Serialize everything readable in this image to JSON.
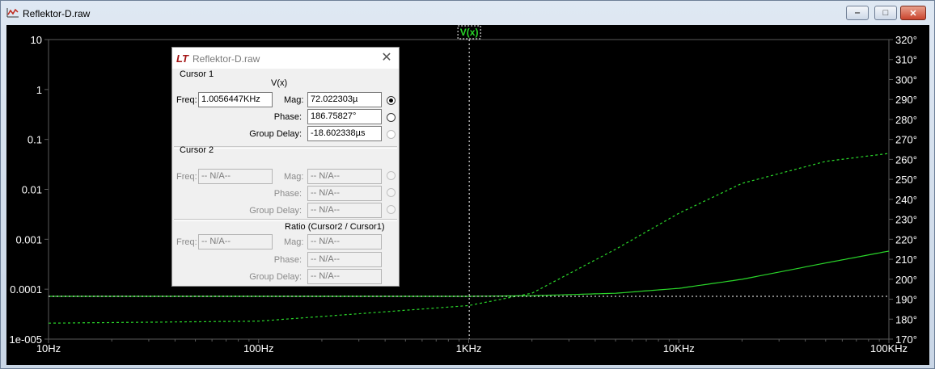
{
  "window": {
    "title": "Reflektor-D.raw",
    "minimize_glyph": "‒",
    "maximize_glyph": "□",
    "close_glyph": "✕"
  },
  "plot": {
    "trace_label": "V(x)",
    "left_ticks": [
      "10",
      "1",
      "0.1",
      "0.01",
      "0.001",
      "0.0001",
      "1e-005"
    ],
    "right_ticks": [
      "320°",
      "310°",
      "300°",
      "290°",
      "280°",
      "270°",
      "260°",
      "250°",
      "240°",
      "230°",
      "220°",
      "210°",
      "200°",
      "190°",
      "180°",
      "170°"
    ],
    "x_ticks": [
      "10Hz",
      "100Hz",
      "1KHz",
      "10KHz",
      "100KHz"
    ],
    "colors": {
      "trace": "#2ad62a",
      "grid": "#5a5a5a",
      "text": "#ffffff",
      "background": "#000000"
    }
  },
  "chart_data": {
    "type": "line",
    "title": "",
    "x_scale": "log",
    "xlim_hz": [
      10,
      100000
    ],
    "y_left": {
      "scale": "log",
      "lim": [
        1e-05,
        10
      ]
    },
    "y_right": {
      "unit": "°",
      "lim": [
        170,
        320
      ]
    },
    "cursor_freq_hz": 1005.6447,
    "cursor_mag": 7.2e-05,
    "series": [
      {
        "axis": "left",
        "style": "solid",
        "x": [
          10,
          100,
          1000,
          2000,
          5000,
          10000,
          20000,
          50000,
          100000
        ],
        "y": [
          7.2e-05,
          7.2e-05,
          7.2e-05,
          7.4e-05,
          8.3e-05,
          0.000104,
          0.000158,
          0.000335,
          0.00058
        ]
      },
      {
        "axis": "right",
        "style": "dashed",
        "x": [
          10,
          100,
          1000,
          2000,
          5000,
          10000,
          20000,
          50000,
          100000
        ],
        "y": [
          178,
          179,
          186.8,
          193,
          215,
          233,
          248,
          259,
          263
        ]
      }
    ]
  },
  "dialog": {
    "title": "Reflektor-D.raw",
    "logo": "LT",
    "cursor1": {
      "header": "Cursor 1",
      "trace": "V(x)",
      "freq_label": "Freq:",
      "freq": "1.0056447KHz",
      "mag_label": "Mag:",
      "mag": "72.022303µ",
      "phase_label": "Phase:",
      "phase": "186.75827°",
      "gd_label": "Group Delay:",
      "gd": "-18.602338µs"
    },
    "cursor2": {
      "header": "Cursor 2",
      "freq_label": "Freq:",
      "freq": "-- N/A--",
      "mag_label": "Mag:",
      "mag": "-- N/A--",
      "phase_label": "Phase:",
      "phase": "-- N/A--",
      "gd_label": "Group Delay:",
      "gd": "-- N/A--"
    },
    "ratio": {
      "header": "Ratio (Cursor2 / Cursor1)",
      "freq_label": "Freq:",
      "freq": "-- N/A--",
      "mag_label": "Mag:",
      "mag": "-- N/A--",
      "phase_label": "Phase:",
      "phase": "-- N/A--",
      "gd_label": "Group Delay:",
      "gd": "-- N/A--"
    }
  }
}
